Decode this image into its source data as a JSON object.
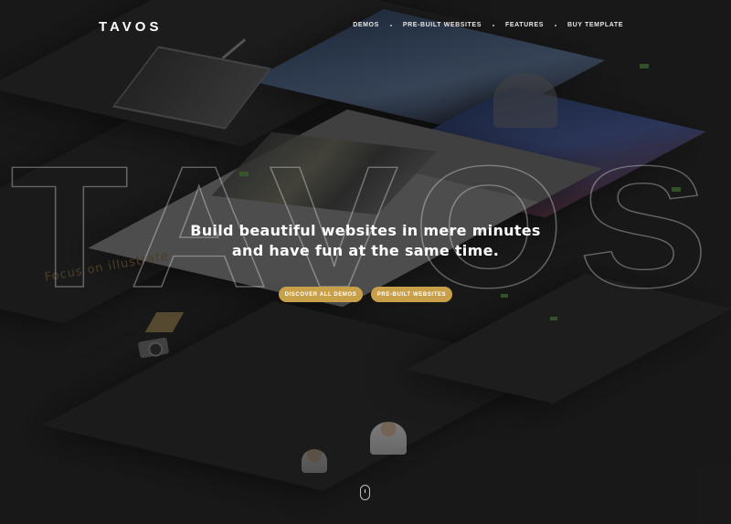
{
  "brand": {
    "logo": "TAVOS"
  },
  "nav": {
    "items": [
      {
        "label": "Demos"
      },
      {
        "label": "Pre-Built Websites"
      },
      {
        "label": "Features"
      },
      {
        "label": "Buy Template"
      }
    ]
  },
  "hero": {
    "watermark": "TAVOS",
    "title_line1": "Build beautiful websites in mere minutes",
    "title_line2": "and have fun at the same time.",
    "primary_button": "Discover All Demos",
    "secondary_button": "Pre-Built Websites"
  },
  "background": {
    "mock_text": "Focus on illustrate"
  },
  "colors": {
    "accent": "#c9a04a",
    "background": "#1c1c1c",
    "text": "#ffffff"
  },
  "icons": {
    "scroll": "mouse-scroll-icon"
  }
}
